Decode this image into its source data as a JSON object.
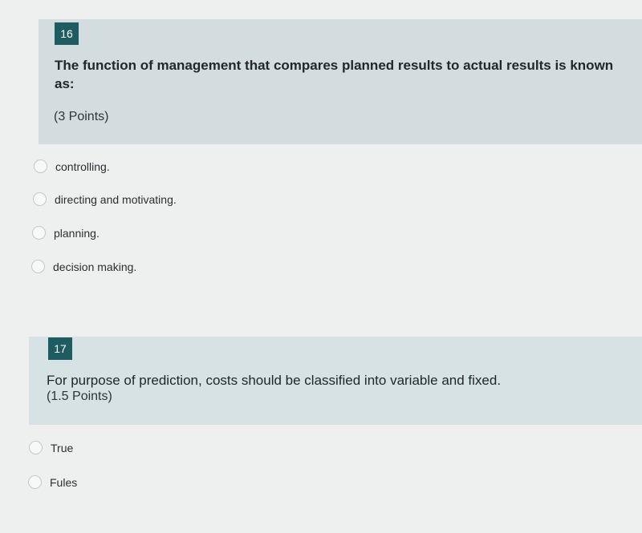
{
  "question16": {
    "number": "16",
    "title": "The function of management that compares planned results to actual results is known as:",
    "points": "(3 Points)",
    "options": [
      "controlling.",
      "directing and motivating.",
      "planning.",
      "decision making."
    ]
  },
  "question17": {
    "number": "17",
    "title": "For purpose of prediction, costs should be classified into variable and fixed.",
    "points": "(1.5 Points)",
    "options": [
      "True",
      "Fules"
    ]
  }
}
